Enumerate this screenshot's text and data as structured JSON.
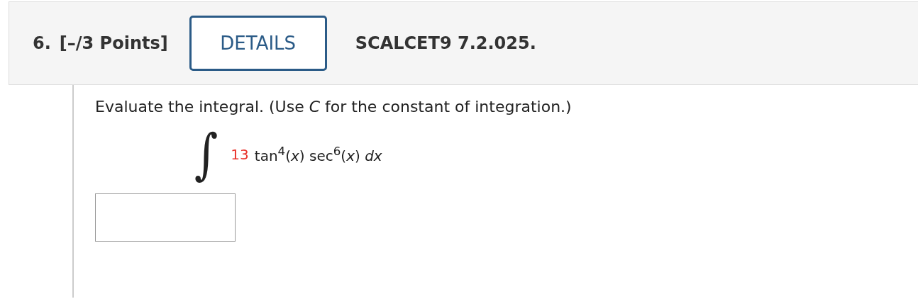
{
  "question": {
    "number": "6.",
    "points": "[–/3 Points]",
    "details_button": "DETAILS",
    "code": "SCALCET9 7.2.025."
  },
  "prompt": "Evaluate the integral. (Use *C* for the constant of integration.)",
  "integral": {
    "sign": "∫",
    "coefficient": "13",
    "expression": "tan$^{4}$(*x*) sec$^{6}$(*x*) *dx*"
  }
}
